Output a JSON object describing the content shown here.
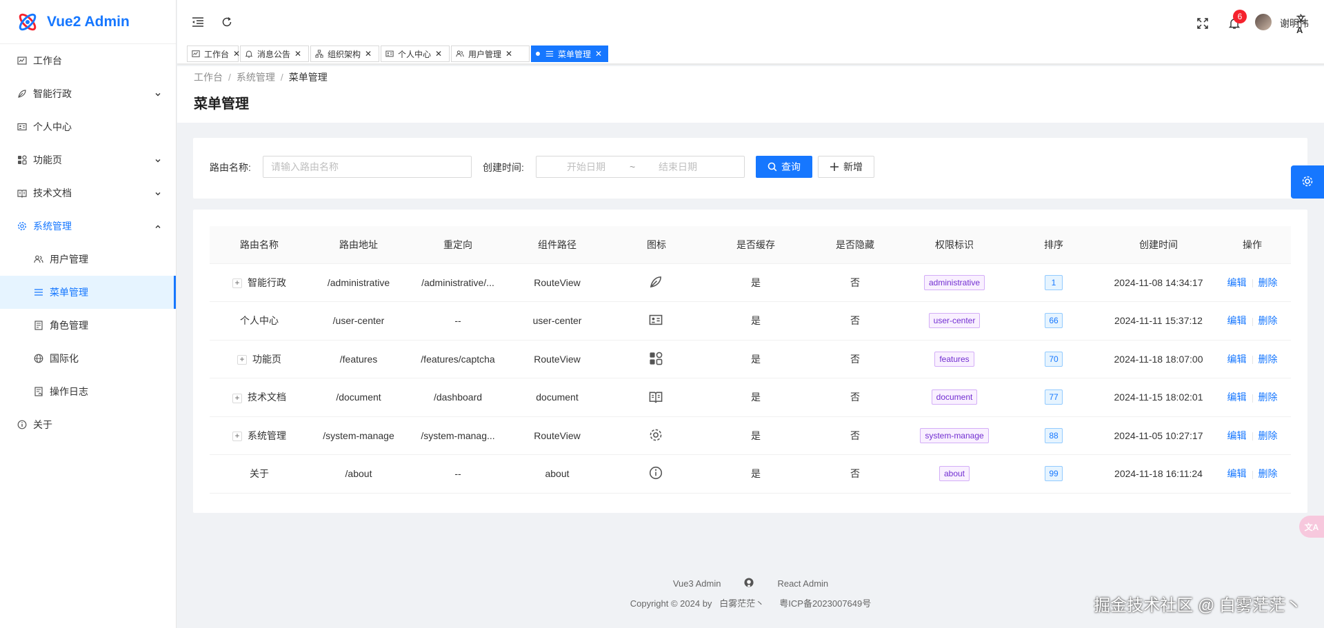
{
  "app": {
    "title": "Vue2 Admin"
  },
  "sidebar": {
    "items": [
      {
        "label": "工作台",
        "icon": "dashboard-icon",
        "has_children": false
      },
      {
        "label": "智能行政",
        "icon": "feather-icon",
        "has_children": true
      },
      {
        "label": "个人中心",
        "icon": "id-card-icon",
        "has_children": false
      },
      {
        "label": "功能页",
        "icon": "apps-icon",
        "has_children": true
      },
      {
        "label": "技术文档",
        "icon": "book-icon",
        "has_children": true
      },
      {
        "label": "系统管理",
        "icon": "gear-icon",
        "has_children": true,
        "expanded": true
      },
      {
        "label": "用户管理",
        "icon": "user-group-icon",
        "sub": true
      },
      {
        "label": "菜单管理",
        "icon": "menu-list-icon",
        "sub": true,
        "selected": true
      },
      {
        "label": "角色管理",
        "icon": "role-icon",
        "sub": true
      },
      {
        "label": "国际化",
        "icon": "globe-icon",
        "sub": true
      },
      {
        "label": "操作日志",
        "icon": "log-icon",
        "sub": true
      },
      {
        "label": "关于",
        "icon": "info-icon",
        "has_children": false
      }
    ]
  },
  "header": {
    "username": "谢明伟",
    "notification_count": "6"
  },
  "tabs": [
    {
      "label": "工作台",
      "icon": "dashboard-icon"
    },
    {
      "label": "消息公告",
      "icon": "bell-icon"
    },
    {
      "label": "组织架构",
      "icon": "org-icon"
    },
    {
      "label": "个人中心",
      "icon": "id-card-icon"
    },
    {
      "label": "用户管理",
      "icon": "user-group-icon"
    },
    {
      "label": "菜单管理",
      "icon": "menu-list-icon",
      "active": true
    }
  ],
  "breadcrumb": [
    "工作台",
    "系统管理",
    "菜单管理"
  ],
  "page_title": "菜单管理",
  "search": {
    "route_name_label": "路由名称:",
    "route_name_placeholder": "请输入路由名称",
    "created_label": "创建时间:",
    "start_placeholder": "开始日期",
    "range_sep": "~",
    "end_placeholder": "结束日期",
    "query_label": "查询",
    "add_label": "新增"
  },
  "table": {
    "columns": [
      "路由名称",
      "路由地址",
      "重定向",
      "组件路径",
      "图标",
      "是否缓存",
      "是否隐藏",
      "权限标识",
      "排序",
      "创建时间",
      "操作"
    ],
    "rows": [
      {
        "name": "智能行政",
        "expandable": true,
        "path": "/administrative",
        "redirect": "/administrative/...",
        "component": "RouteView",
        "icon": "feather-icon",
        "cache": "是",
        "hidden": "否",
        "perm": "administrative",
        "sort": "1",
        "created": "2024-11-08 14:34:17"
      },
      {
        "name": "个人中心",
        "expandable": false,
        "path": "/user-center",
        "redirect": "--",
        "component": "user-center",
        "icon": "id-card-icon",
        "cache": "是",
        "hidden": "否",
        "perm": "user-center",
        "sort": "66",
        "created": "2024-11-11 15:37:12"
      },
      {
        "name": "功能页",
        "expandable": true,
        "path": "/features",
        "redirect": "/features/captcha",
        "component": "RouteView",
        "icon": "apps-icon",
        "cache": "是",
        "hidden": "否",
        "perm": "features",
        "sort": "70",
        "created": "2024-11-18 18:07:00"
      },
      {
        "name": "技术文档",
        "expandable": true,
        "path": "/document",
        "redirect": "/dashboard",
        "component": "document",
        "icon": "book-icon",
        "cache": "是",
        "hidden": "否",
        "perm": "document",
        "sort": "77",
        "created": "2024-11-15 18:02:01"
      },
      {
        "name": "系统管理",
        "expandable": true,
        "path": "/system-manage",
        "redirect": "/system-manag...",
        "component": "RouteView",
        "icon": "gear-icon",
        "cache": "是",
        "hidden": "否",
        "perm": "system-manage",
        "sort": "88",
        "created": "2024-11-05 10:27:17"
      },
      {
        "name": "关于",
        "expandable": false,
        "path": "/about",
        "redirect": "--",
        "component": "about",
        "icon": "info-icon",
        "cache": "是",
        "hidden": "否",
        "perm": "about",
        "sort": "99",
        "created": "2024-11-18 16:11:24"
      }
    ],
    "edit_label": "编辑",
    "delete_label": "删除"
  },
  "footer": {
    "link1": "Vue3 Admin",
    "link2": "React Admin",
    "copyright": "Copyright © 2024 by",
    "author": "白雾茫茫丶",
    "icp": "粤ICP备2023007649号"
  },
  "watermark": "掘金技术社区 @ 白雾茫茫丶",
  "colors": {
    "primary": "#1677ff",
    "perm_tag": "#722ed1",
    "badge": "#f5222d"
  }
}
